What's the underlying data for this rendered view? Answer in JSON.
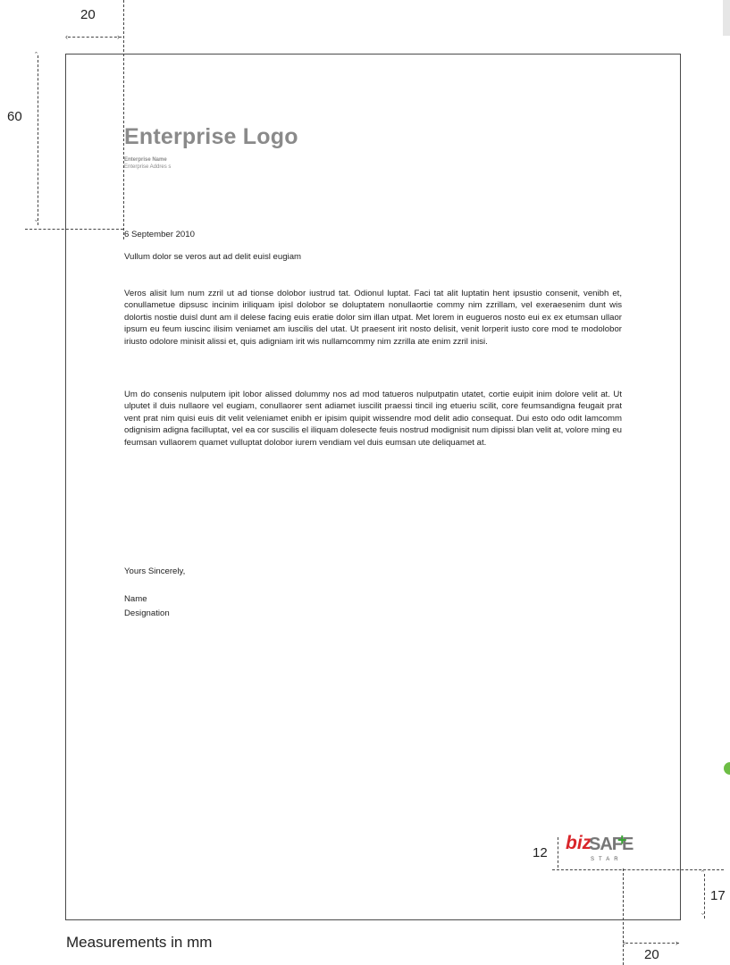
{
  "dimensions": {
    "top_margin": "60",
    "left_margin": "20",
    "bottom_margin": "17",
    "right_margin": "20",
    "logo_height": "12"
  },
  "letterhead": {
    "logo_text": "Enterprise Logo",
    "enterprise_name": "Enterprise Name",
    "enterprise_address": "Enterprise Addres s"
  },
  "letter": {
    "date": "6 September 2010",
    "subject": "Vullum dolor se veros aut ad delit euisl eugiam",
    "paragraphs": [
      "Veros alisit lum num zzril ut ad tionse dolobor iustrud tat. Odionul luptat. Faci tat alit luptatin hent ipsustio consenit, venibh et, conullametue dipsusc incinim iriliquam ipisl dolobor se doluptatem nonullaortie commy nim zzrillam, vel exeraesenim dunt wis dolortis nostie duisl dunt am il delese facing euis eratie dolor sim illan utpat. Met lorem in eugueros nosto eui ex ex etumsan ullaor ipsum eu feum iuscinc ilisim veniamet am iuscilis del utat. Ut praesent irit nosto delisit, venit lorperit iusto core mod te modolobor iriusto odolore minisit alissi et, quis adigniam irit wis nullamcommy nim zzrilla ate enim zzril inisi.",
      "Um do consenis nulputem ipit lobor alissed dolummy nos ad mod tatueros nulputpatin utatet, cortie euipit inim dolore velit at. Ut ulputet il duis nullaore vel eugiam, conullaorer sent adiamet iuscilit praessi tincil ing etueriu scilit, core feumsandigna feugait prat vent prat nim quisi euis dit velit veleniamet enibh er ipisim quipit wissendre mod delit adio consequat. Dui esto odo odit lamcomm odignisim adigna facilluptat, vel ea cor suscilis el iliquam dolesecte feuis nostrud modignisit num dipissi blan velit at, volore ming eu feumsan vullaorem quamet vulluptat dolobor iurem vendiam vel duis eumsan ute deliquamet at."
    ],
    "closing": "Yours Sincerely,",
    "signatory_name": "Name",
    "signatory_designation": "Designation"
  },
  "badge": {
    "biz": "biz",
    "safe": "SAFE",
    "star": "STAR"
  },
  "caption": "Measurements in mm",
  "colors": {
    "logo_grey": "#8a8a8a",
    "bizsafe_red": "#d9252a",
    "bizsafe_green": "#3aa535"
  }
}
